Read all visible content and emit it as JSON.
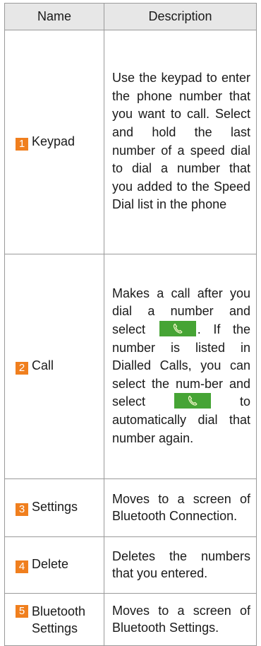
{
  "table": {
    "headers": {
      "name": "Name",
      "description": "Description"
    },
    "rows": [
      {
        "number": "1",
        "name": "Keypad",
        "description": "Use the keypad to enter the phone number that you want to call. Select and hold the last number of a speed dial to dial a number that you added to the Speed Dial list in the phone"
      },
      {
        "number": "2",
        "name": "Call",
        "description_part1": "Makes a call after you dial a number and select",
        "description_part2": ". If the number is listed in Dialled Calls, you can select the num-ber and select",
        "description_part3": "to automatically dial that number again.",
        "icon": "phone-call-icon",
        "icon_color": "#46a435"
      },
      {
        "number": "3",
        "name": "Settings",
        "description": "Moves to a screen of Bluetooth Connection."
      },
      {
        "number": "4",
        "name": "Delete",
        "description": "Deletes the numbers that you entered."
      },
      {
        "number": "5",
        "name_line1": "Bluetooth",
        "name_line2": "Settings",
        "description": "Moves to a screen of Bluetooth Settings."
      }
    ]
  },
  "colors": {
    "badge": "#f07f1e",
    "header_bg": "#e7e7e7",
    "border": "#9a9a9a"
  }
}
